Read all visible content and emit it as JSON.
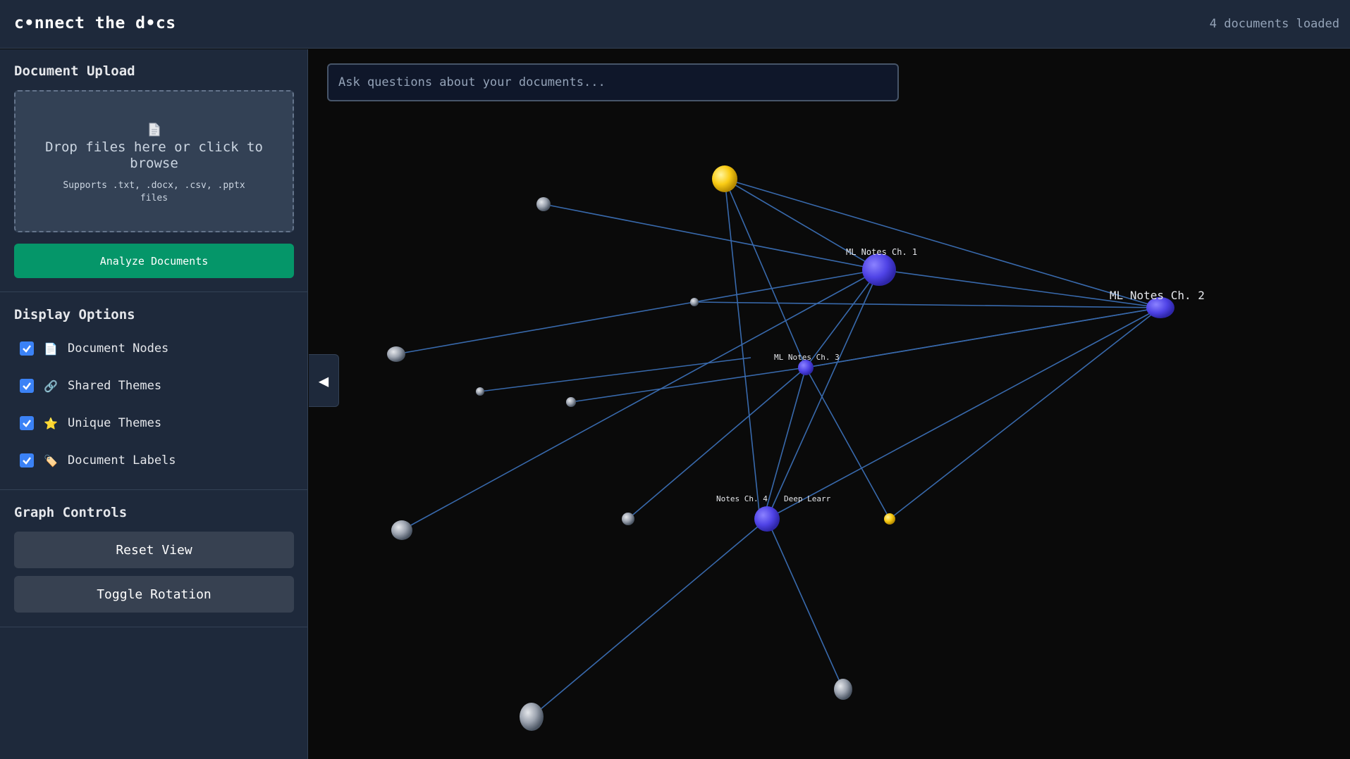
{
  "header": {
    "logo": "c•nnect the d•cs",
    "status": "4 documents loaded"
  },
  "upload": {
    "title": "Document Upload",
    "icon": "document-icon",
    "drop_text": "Drop files here or click to browse",
    "supports": "Supports .txt, .docx, .csv, .pptx files",
    "analyze_label": "Analyze Documents"
  },
  "display": {
    "title": "Display Options",
    "options": [
      {
        "label": "Document Nodes",
        "icon": "📄",
        "checked": true
      },
      {
        "label": "Shared Themes",
        "icon": "🔗",
        "checked": true
      },
      {
        "label": "Unique Themes",
        "icon": "⭐",
        "checked": true
      },
      {
        "label": "Document Labels",
        "icon": "🏷️",
        "checked": true
      }
    ]
  },
  "controls": {
    "title": "Graph Controls",
    "reset_label": "Reset View",
    "toggle_label": "Toggle Rotation"
  },
  "search": {
    "placeholder": "Ask questions about your documents..."
  },
  "collapse": {
    "icon": "◀"
  },
  "graph": {
    "labels": {
      "doc1": "ML Notes Ch. 1",
      "doc2": "ML Notes Ch. 2",
      "doc3": "ML Notes Ch. 3",
      "doc4": "Notes Ch. 4",
      "doc5": "Deep Learr"
    }
  },
  "colors": {
    "doc_node": "#5b4df0",
    "unique_theme": "#facc15",
    "shared_theme": "#9ca3af",
    "edge": "#3b6fb5",
    "accent": "#059669"
  }
}
